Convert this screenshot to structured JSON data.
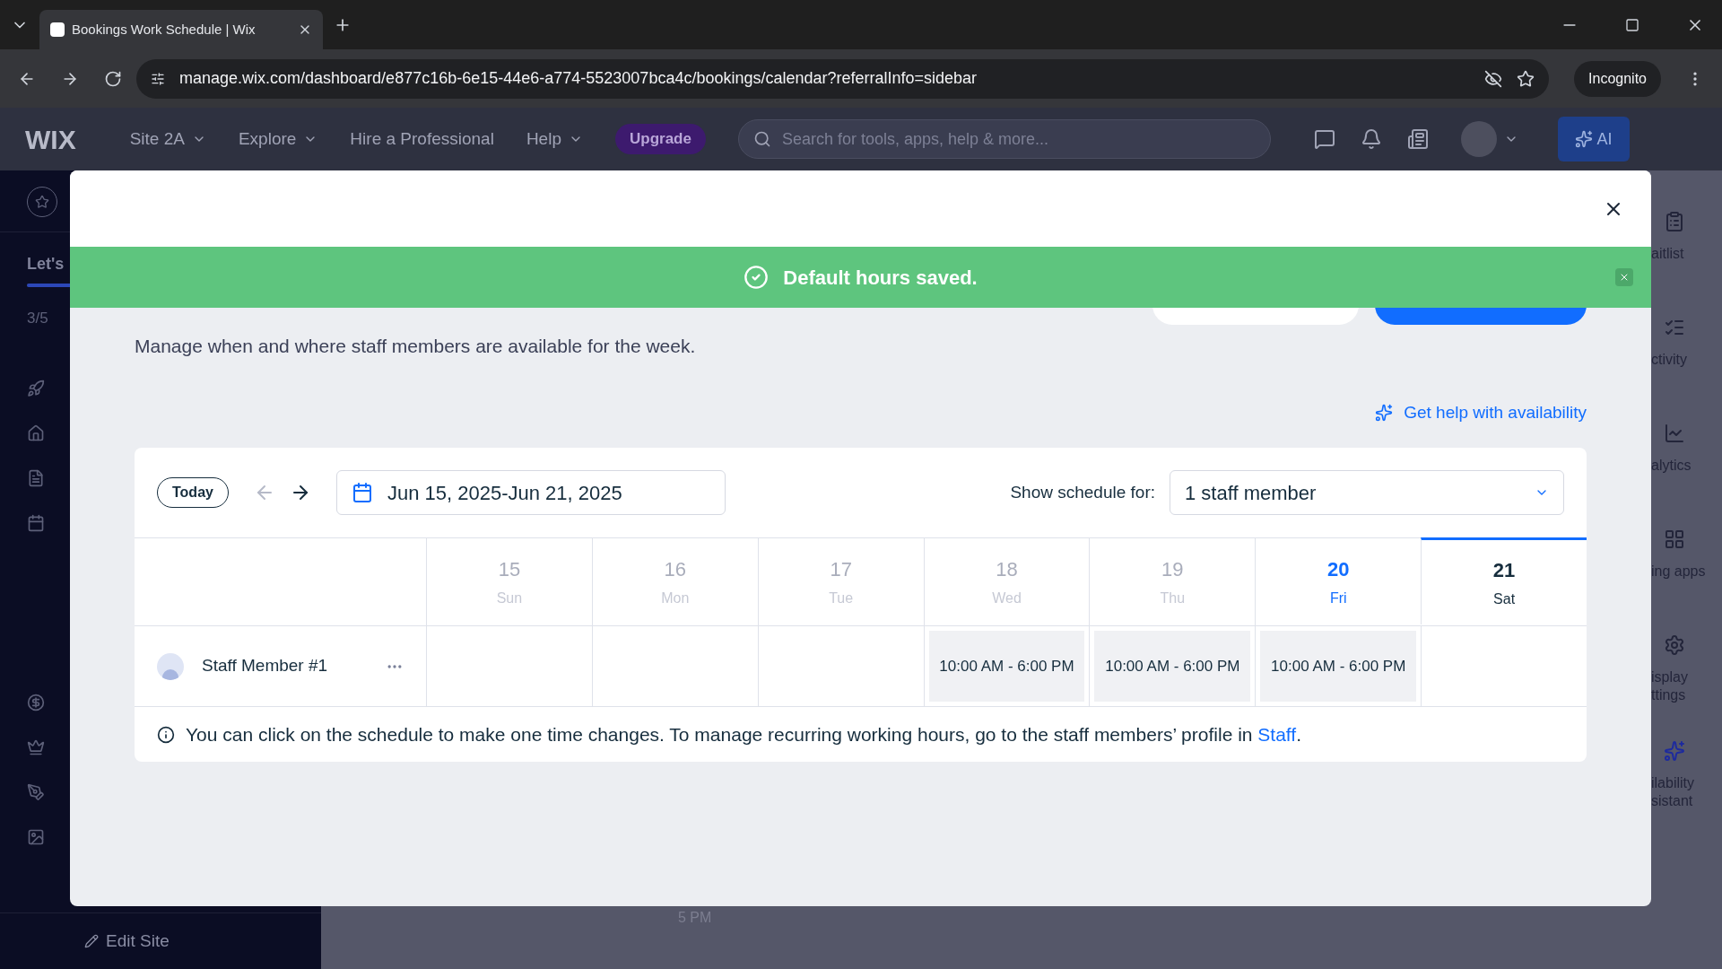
{
  "browser": {
    "tab_title": "Bookings Work Schedule | Wix",
    "url": "manage.wix.com/dashboard/e877c16b-6e15-44e6-a774-5523007bca4c/bookings/calendar?referralInfo=sidebar",
    "incognito": "Incognito"
  },
  "header": {
    "logo": "WIX",
    "menu": [
      {
        "label": "Site 2A",
        "dropdown": true
      },
      {
        "label": "Explore",
        "dropdown": true
      },
      {
        "label": "Hire a Professional",
        "dropdown": false
      },
      {
        "label": "Help",
        "dropdown": true
      }
    ],
    "upgrade": "Upgrade",
    "search": {
      "placeholder": "Search for tools, apps, help & more..."
    },
    "ai": "AI"
  },
  "sidebar": {
    "heading": "Let's",
    "setup": {
      "level": 0.6,
      "text": "3/5"
    },
    "edit_site": "Edit Site"
  },
  "right_panel": [
    {
      "label": "aitlist"
    },
    {
      "label": "ctivity"
    },
    {
      "label": "alytics"
    },
    {
      "label": "ing apps"
    },
    {
      "label": "isplay\nttings"
    },
    {
      "label": "ilability\nsistant"
    }
  ],
  "background_time": "5 PM",
  "modal": {
    "toast": "Default hours saved.",
    "subtitle": "Manage when and where staff members are available for the week.",
    "help_link": "Get help with availability",
    "toolbar": {
      "today": "Today",
      "range": "Jun 15, 2025-Jun 21, 2025",
      "show_label": "Show schedule for:",
      "show_value": "1 staff member"
    },
    "days": [
      {
        "date": "15",
        "day": "Sun",
        "kind": "past",
        "selected": false
      },
      {
        "date": "16",
        "day": "Mon",
        "kind": "past",
        "selected": false
      },
      {
        "date": "17",
        "day": "Tue",
        "kind": "past",
        "selected": false
      },
      {
        "date": "18",
        "day": "Wed",
        "kind": "past",
        "selected": false
      },
      {
        "date": "19",
        "day": "Thu",
        "kind": "past",
        "selected": false
      },
      {
        "date": "20",
        "day": "Fri",
        "kind": "today",
        "selected": false
      },
      {
        "date": "21",
        "day": "Sat",
        "kind": "future",
        "selected": true
      }
    ],
    "staff": [
      {
        "name": "Staff Member #1",
        "cells": [
          {
            "kind": "empty"
          },
          {
            "kind": "empty"
          },
          {
            "kind": "empty"
          },
          {
            "kind": "hours",
            "text": "10:00 AM - 6:00 PM"
          },
          {
            "kind": "hours",
            "text": "10:00 AM - 6:00 PM"
          },
          {
            "kind": "hours",
            "text": "10:00 AM - 6:00 PM"
          },
          {
            "kind": "empty"
          }
        ]
      }
    ],
    "note": "You can click on the schedule to make one time changes. To manage recurring working hours, go to the staff members’ profile in",
    "note_link": "Staff",
    "note_end": "."
  }
}
